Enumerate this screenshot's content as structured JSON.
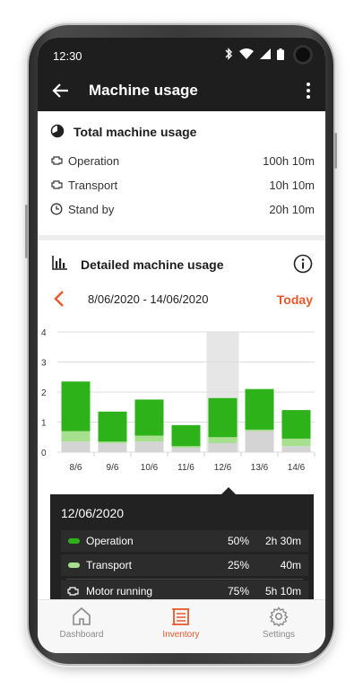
{
  "status": {
    "time": "12:30"
  },
  "appbar": {
    "title": "Machine usage"
  },
  "total": {
    "title": "Total machine usage",
    "rows": [
      {
        "icon": "engine-icon",
        "label": "Operation",
        "value": "100h 10m"
      },
      {
        "icon": "engine-icon",
        "label": "Transport",
        "value": "10h 10m"
      },
      {
        "icon": "clock-icon",
        "label": "Stand by",
        "value": "20h 10m"
      }
    ]
  },
  "detailed": {
    "title": "Detailed machine usage",
    "date_range": "8/06/2020 - 14/06/2020",
    "today_label": "Today"
  },
  "colors": {
    "operation": "#2db21a",
    "transport": "#a6e08f",
    "standby": "#d4d4d4",
    "selected_bg": "#e6e6e6",
    "accent": "#e8582b"
  },
  "chart_data": {
    "type": "bar",
    "stacked": true,
    "categories": [
      "8/6",
      "9/6",
      "10/6",
      "11/6",
      "12/6",
      "13/6",
      "14/6"
    ],
    "ylim": [
      0,
      4
    ],
    "yticks": [
      0,
      1,
      2,
      3,
      4
    ],
    "grid": true,
    "selected_index": 4,
    "series": [
      {
        "key": "standby",
        "values": [
          0.35,
          0.3,
          0.35,
          0.15,
          0.3,
          0.7,
          0.2
        ]
      },
      {
        "key": "transport",
        "values": [
          0.35,
          0.05,
          0.2,
          0.05,
          0.2,
          0.05,
          0.25
        ]
      },
      {
        "key": "operation",
        "values": [
          1.65,
          1.0,
          1.2,
          0.7,
          1.3,
          1.35,
          0.95
        ]
      }
    ]
  },
  "tooltip": {
    "date": "12/06/2020",
    "rows": [
      {
        "name": "Operation",
        "pct": "50%",
        "dur": "2h 30m"
      },
      {
        "name": "Transport",
        "pct": "25%",
        "dur": "40m"
      },
      {
        "name": "Motor running",
        "pct": "75%",
        "dur": "5h 10m"
      }
    ]
  },
  "nav": {
    "items": [
      {
        "label": "Dashboard",
        "icon": "home-icon"
      },
      {
        "label": "Inventory",
        "icon": "inventory-icon"
      },
      {
        "label": "Settings",
        "icon": "gear-icon"
      }
    ],
    "active_index": 1
  }
}
